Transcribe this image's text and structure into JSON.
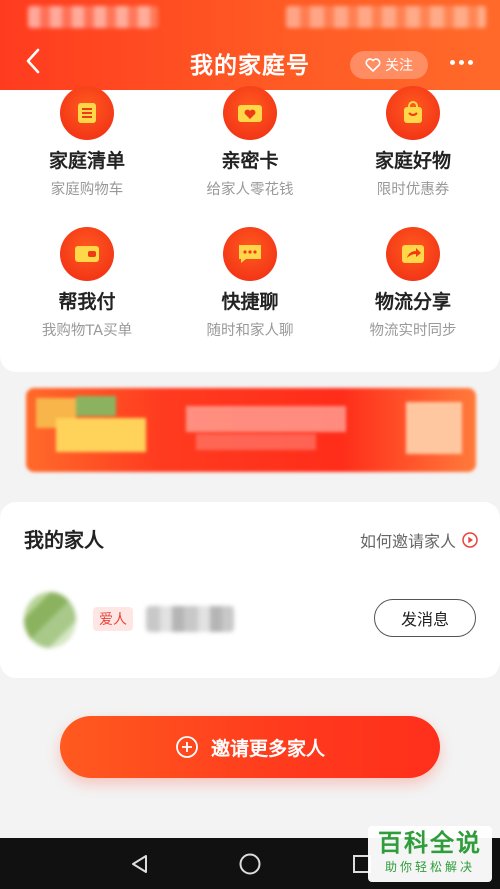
{
  "header": {
    "title": "我的家庭号",
    "follow_label": "关注"
  },
  "services": [
    {
      "title": "家庭清单",
      "subtitle": "家庭购物车",
      "icon": "list-icon"
    },
    {
      "title": "亲密卡",
      "subtitle": "给家人零花钱",
      "icon": "heart-card-icon"
    },
    {
      "title": "家庭好物",
      "subtitle": "限时优惠券",
      "icon": "shopping-bag-icon"
    },
    {
      "title": "帮我付",
      "subtitle": "我购物TA买单",
      "icon": "wallet-icon"
    },
    {
      "title": "快捷聊",
      "subtitle": "随时和家人聊",
      "icon": "chat-icon"
    },
    {
      "title": "物流分享",
      "subtitle": "物流实时同步",
      "icon": "share-icon"
    }
  ],
  "family": {
    "title": "我的家人",
    "invite_link": "如何邀请家人",
    "members": [
      {
        "relation": "爱人",
        "message_label": "发消息"
      }
    ]
  },
  "invite_more_label": "邀请更多家人",
  "watermark": {
    "main": "百科全说",
    "sub": "助你轻松解决"
  },
  "colors": {
    "brand": "#ff3b1f",
    "accent_green": "#2e9d3a"
  }
}
